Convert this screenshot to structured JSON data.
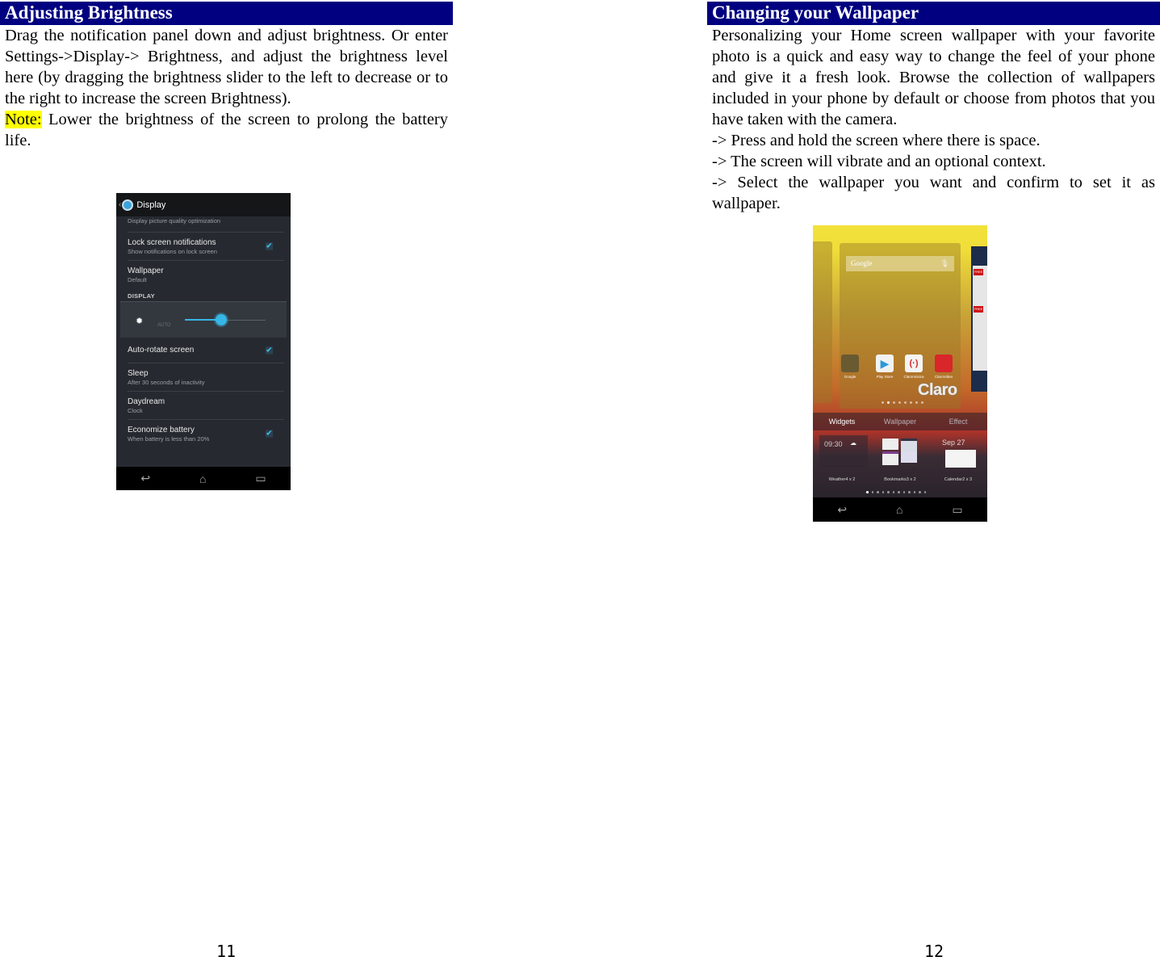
{
  "left_page": {
    "heading": "Adjusting Brightness",
    "paragraph": "Drag the notification panel down and adjust brightness. Or enter Settings->Display-> Brightness, and adjust the brightness level here (by dragging the brightness slider to the left to decrease or to the right to increase the screen Brightness).",
    "note_label": "Note:",
    "note_text": " Lower the brightness of the screen to prolong the battery life.",
    "page_number": "11",
    "screenshot": {
      "header_title": "Display",
      "first_item_subtitle": "Display picture quality optimization",
      "items_top": [
        {
          "title": "Lock screen notifications",
          "subtitle": "Show notifications on lock screen",
          "checked": true
        },
        {
          "title": "Wallpaper",
          "subtitle": "Default",
          "checked": false
        }
      ],
      "section_label": "DISPLAY",
      "brightness": {
        "auto_label": "AUTO",
        "level": 0.45
      },
      "items_bottom": [
        {
          "title": "Auto-rotate screen",
          "subtitle": "",
          "checked": true
        },
        {
          "title": "Sleep",
          "subtitle": "After 30 seconds of inactivity",
          "checked": false
        },
        {
          "title": "Daydream",
          "subtitle": "Clock",
          "checked": false
        },
        {
          "title": "Economize battery",
          "subtitle": "When battery is less than 20%",
          "checked": true
        }
      ],
      "nav": {
        "back": "↩",
        "home": "⌂",
        "recents": "▭"
      }
    }
  },
  "right_page": {
    "heading": "Changing your Wallpaper",
    "paragraph": "Personalizing your Home screen wallpaper with your favorite photo is a quick and easy way to change the feel of your phone and give it a fresh look. Browse the collection of wallpapers included in your phone by default or choose from photos that you have taken with the camera.",
    "steps": [
      "-> Press and hold the screen where there is space.",
      "-> The screen will vibrate and an optional context.",
      "-> Select the wallpaper you want and confirm to set it as wallpaper."
    ],
    "page_number": "12",
    "screenshot": {
      "search_label": "Google",
      "free_badge": "FREE",
      "apps": [
        {
          "label": "Google",
          "color": "#6a5a32"
        },
        {
          "label": "Play Store",
          "color": "#f2f2f2"
        },
        {
          "label": "Claromúsica",
          "color": "#f4f4f4"
        },
        {
          "label": "ClaroVideo",
          "color": "#d8262a"
        }
      ],
      "brand": "Claro",
      "tabs": [
        "Widgets",
        "Wallpaper",
        "Effect"
      ],
      "active_tab": "Widgets",
      "widgets": [
        "Weather4 x 2",
        "Bookmarks3 x 2",
        "Calendar2 x 3"
      ],
      "widget_clock": "09:30",
      "widget_date": "Sep 27",
      "nav": {
        "back": "↩",
        "home": "⌂",
        "recents": "▭"
      }
    }
  }
}
